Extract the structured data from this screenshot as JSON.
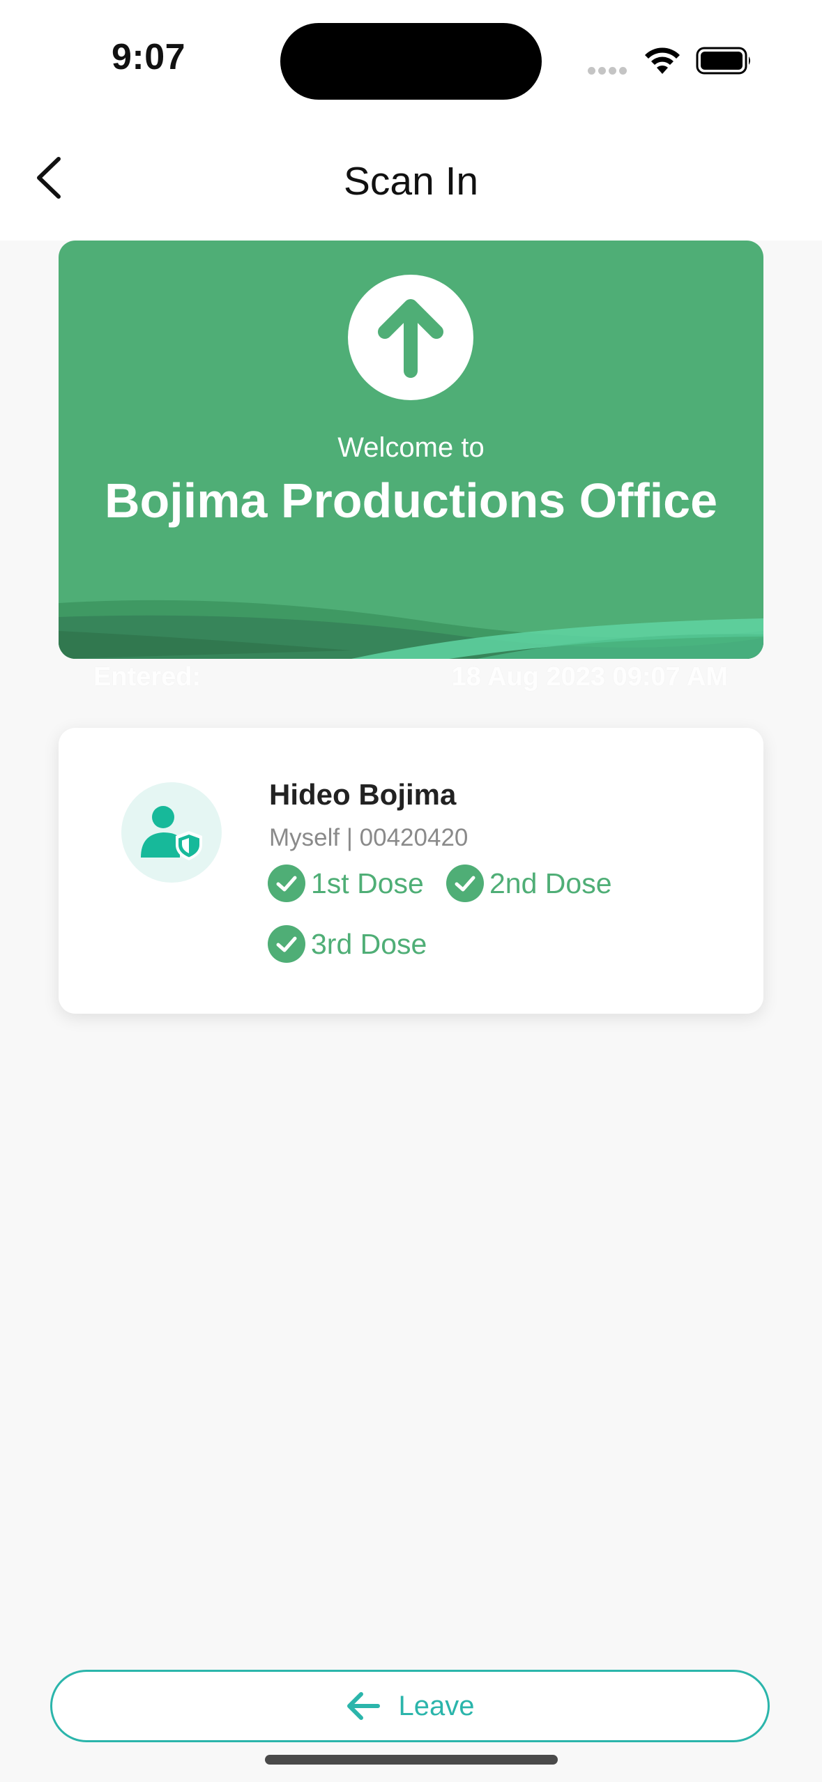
{
  "status_bar": {
    "time": "9:07"
  },
  "nav": {
    "title": "Scan In",
    "back_icon": "chevron-left-icon"
  },
  "welcome_card": {
    "background": "#4fae76",
    "icon": "arrow-up-icon",
    "label": "Welcome to",
    "office_name": "Bojima Productions Office"
  },
  "entered": {
    "label": "Entered:",
    "value": "18 Aug 2023 09:07 AM"
  },
  "person": {
    "avatar_icon": "user-shield-icon",
    "name": "Hideo Bojima",
    "relation_id": "Myself | 00420420",
    "doses": [
      "1st Dose",
      "2nd Dose",
      "3rd Dose"
    ],
    "dose_color": "#4fae76"
  },
  "leave_button": {
    "label": "Leave",
    "icon": "arrow-left-icon",
    "color": "#2bb5ab"
  }
}
